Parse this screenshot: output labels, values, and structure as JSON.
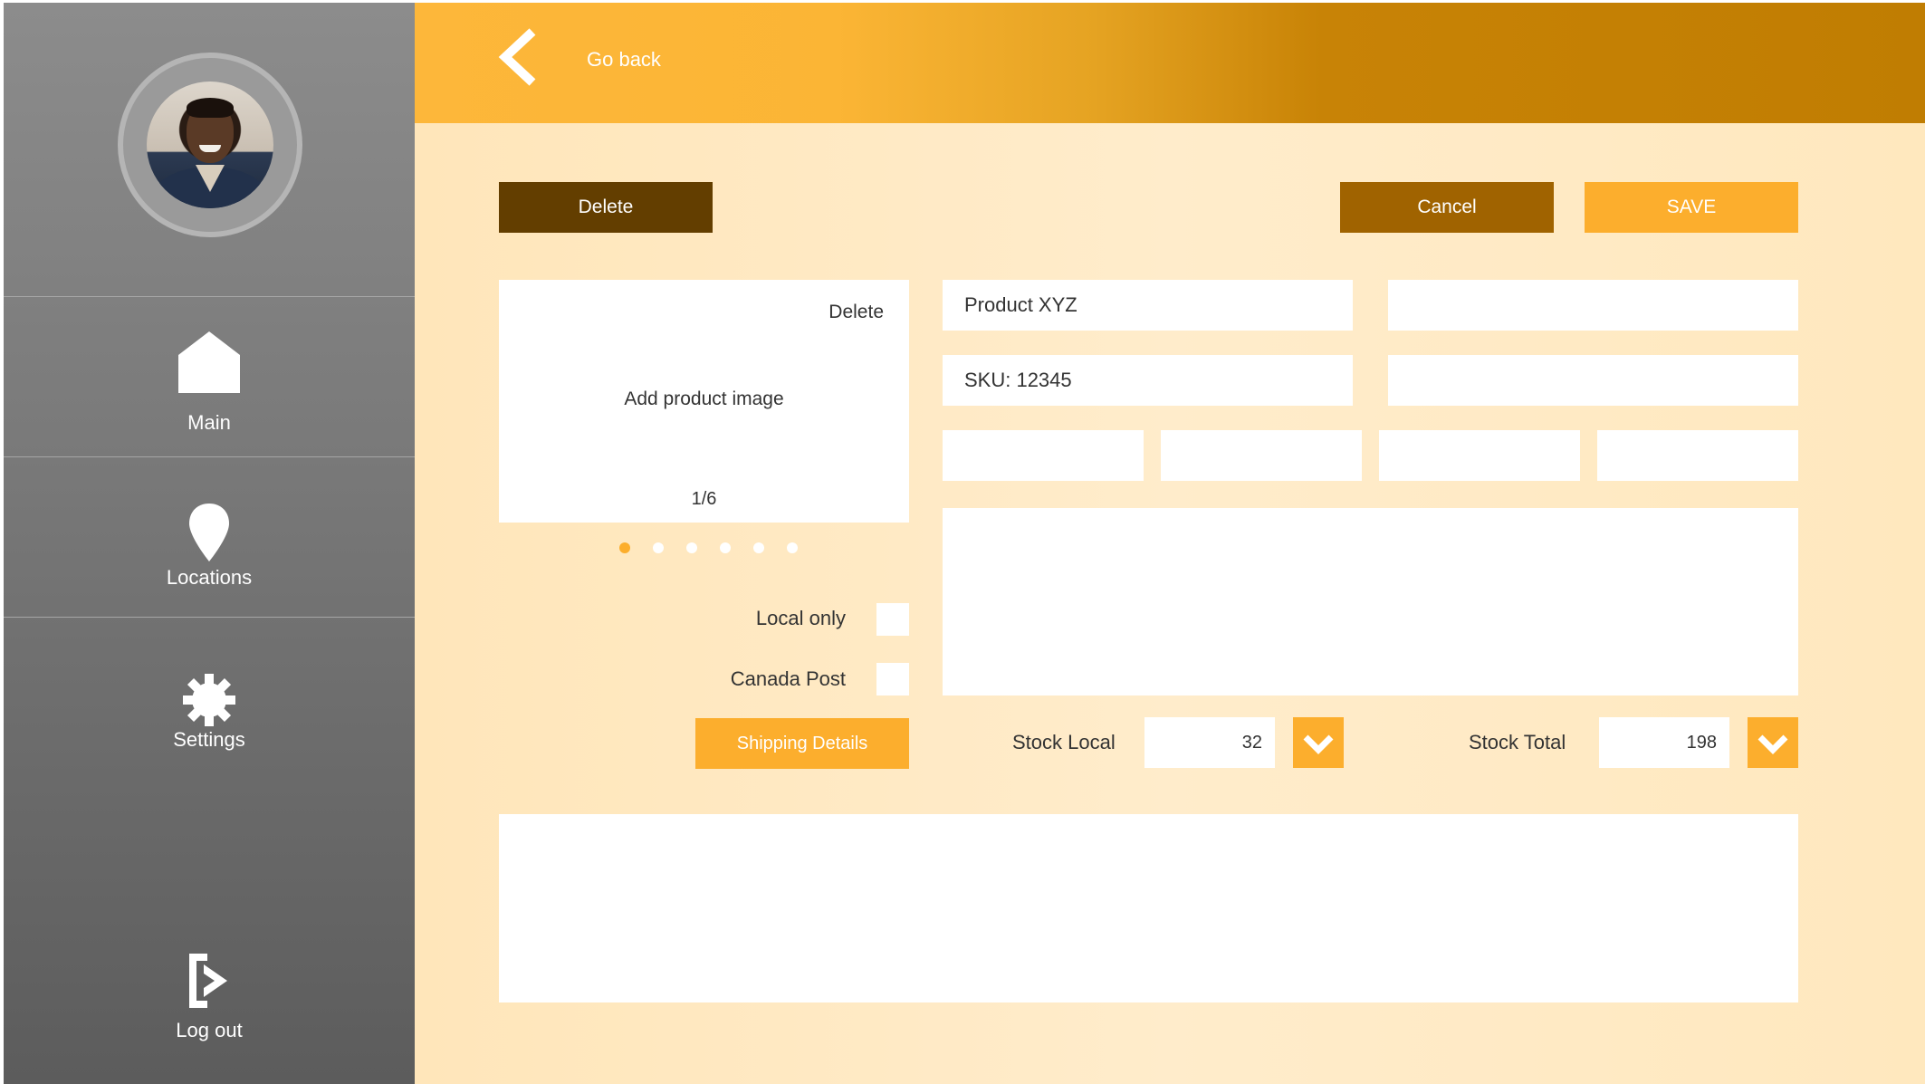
{
  "sidebar": {
    "items": [
      {
        "label": "Main",
        "icon": "home-icon"
      },
      {
        "label": "Locations",
        "icon": "location-pin-icon"
      },
      {
        "label": "Settings",
        "icon": "gear-icon"
      },
      {
        "label": "Log out",
        "icon": "logout-icon"
      }
    ]
  },
  "header": {
    "back_label": "Go back",
    "back_icon": "chevron-left-icon"
  },
  "toolbar": {
    "delete_label": "Delete",
    "cancel_label": "Cancel",
    "save_label": "SAVE"
  },
  "image_panel": {
    "delete_label": "Delete",
    "add_label": "Add product image",
    "counter": "1/6",
    "total_images": 6,
    "active_index": 0
  },
  "fields": {
    "product_name": "Product XYZ",
    "sku": "SKU: 12345"
  },
  "shipping": {
    "local_only_label": "Local only",
    "canada_post_label": "Canada Post",
    "details_button": "Shipping Details"
  },
  "stock": {
    "local_label": "Stock Local",
    "local_value": "32",
    "total_label": "Stock Total",
    "total_value": "198"
  },
  "colors": {
    "accent": "#fcae2d",
    "dark_brown": "#633e00",
    "medium_brown": "#a06300"
  }
}
